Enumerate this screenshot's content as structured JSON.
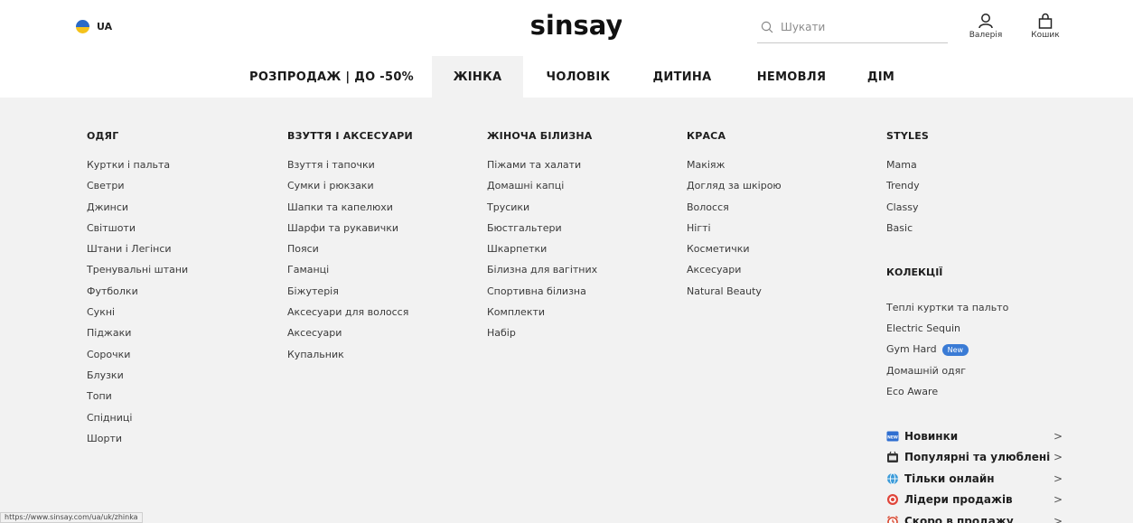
{
  "header": {
    "lang": "UA",
    "logo": "sinsay",
    "search_placeholder": "Шукати",
    "account_label": "Валерія",
    "cart_label": "Кошик"
  },
  "nav": [
    {
      "label": "РОЗПРОДАЖ | ДО -50%",
      "active": false
    },
    {
      "label": "ЖІНКА",
      "active": true
    },
    {
      "label": "ЧОЛОВІК",
      "active": false
    },
    {
      "label": "ДИТИНА",
      "active": false
    },
    {
      "label": "НЕМОВЛЯ",
      "active": false
    },
    {
      "label": "ДІМ",
      "active": false
    }
  ],
  "columns": [
    {
      "title": "ОДЯГ",
      "items": [
        "Куртки і пальта",
        "Светри",
        "Джинси",
        "Світшоти",
        "Штани і Легінси",
        "Тренувальні штани",
        "Футболки",
        "Сукні",
        "Піджаки",
        "Сорочки",
        "Блузки",
        "Топи",
        "Спідниці",
        "Шорти"
      ]
    },
    {
      "title": "ВЗУТТЯ І АКСЕСУАРИ",
      "items": [
        "Взуття і тапочки",
        "Сумки і рюкзаки",
        "Шапки та капелюхи",
        "Шарфи та рукавички",
        "Пояси",
        "Гаманці",
        "Біжутерія",
        "Аксесуари для волосся",
        "Аксесуари",
        "Купальник"
      ]
    },
    {
      "title": "ЖІНОЧА БІЛИЗНА",
      "items": [
        "Піжами та халати",
        "Домашні капці",
        "Трусики",
        "Бюстгальтери",
        "Шкарпетки",
        "Білизна для вагітних",
        "Спортивна білизна",
        "Комплекти",
        "Набір"
      ]
    },
    {
      "title": "КРАСА",
      "items": [
        "Макіяж",
        "Догляд за шкірою",
        "Волосся",
        "Нігті",
        "Косметички",
        "Аксесуари",
        "Natural Beauty"
      ]
    },
    {
      "title": "STYLES",
      "items": [
        "Mama",
        "Trendy",
        "Classy",
        "Basic"
      ]
    }
  ],
  "collections": {
    "title": "КОЛЕКЦІЇ",
    "items": [
      {
        "label": "Теплі куртки та пальто",
        "badge": ""
      },
      {
        "label": "Electric Sequin",
        "badge": ""
      },
      {
        "label": "Gym Hard",
        "badge": "New"
      },
      {
        "label": "Домашній одяг",
        "badge": ""
      },
      {
        "label": "Eco Aware",
        "badge": ""
      }
    ]
  },
  "promo": [
    {
      "label": "Новинки",
      "icon": "new-badge-icon",
      "chevron": ">"
    },
    {
      "label": "Популярні та улюблені",
      "icon": "popular-icon",
      "chevron": ">"
    },
    {
      "label": "Тільки онлайн",
      "icon": "globe-icon",
      "chevron": ">"
    },
    {
      "label": "Лідери продажів",
      "icon": "target-icon",
      "chevron": ">"
    },
    {
      "label": "Скоро в продажу",
      "icon": "alarm-clock-icon",
      "chevron": ">"
    }
  ],
  "status_url": "https://www.sinsay.com/ua/uk/zhinka",
  "colors": {
    "dropdown_bg": "#f2f2f2",
    "badge_blue": "#3a7bd5",
    "flag_blue": "#2a6ac7",
    "flag_yellow": "#f4c21b"
  }
}
